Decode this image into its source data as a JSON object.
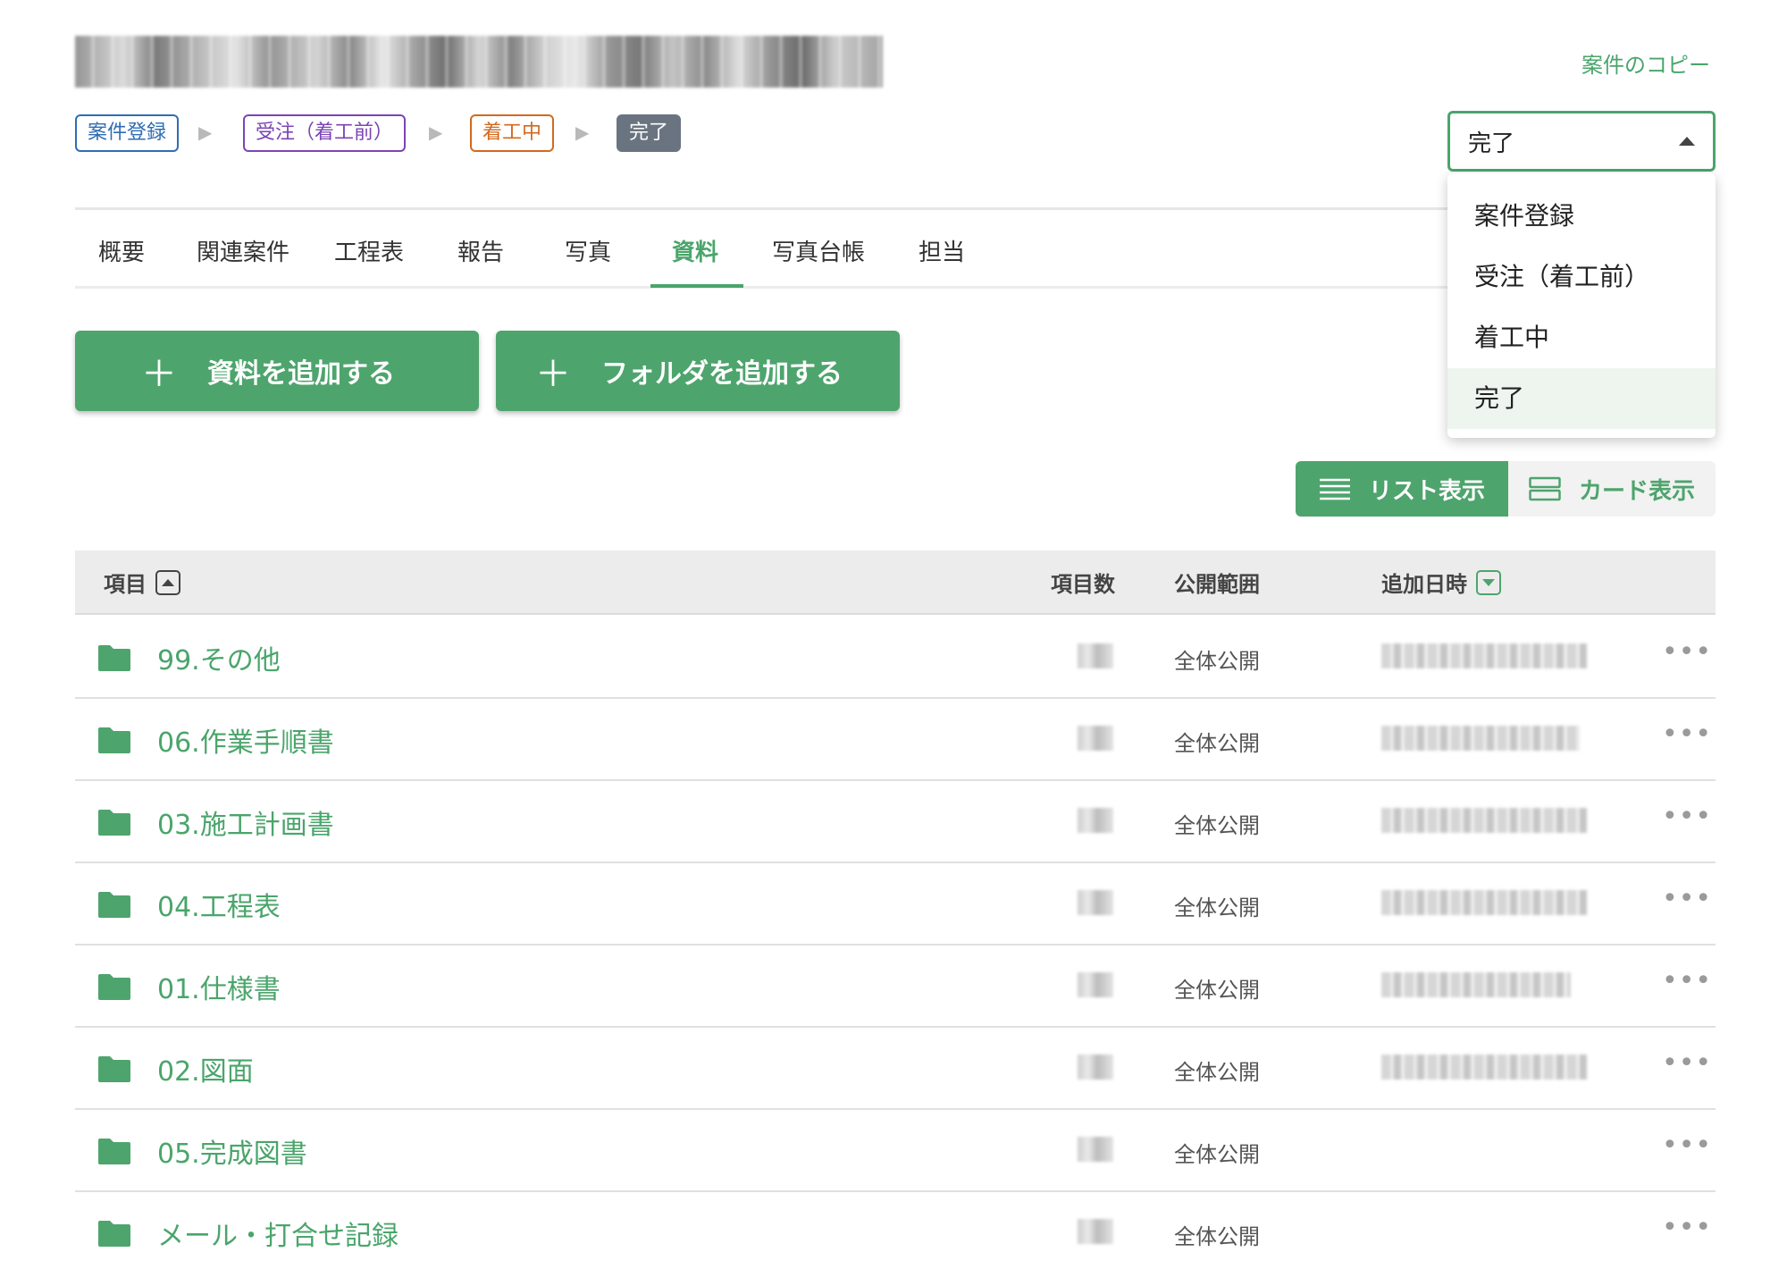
{
  "header": {
    "copy_label": "案件のコピー"
  },
  "status_flow": {
    "steps": [
      "案件登録",
      "受注（着工前）",
      "着工中",
      "完了"
    ],
    "arrow": "▶"
  },
  "status_select": {
    "value": "完了",
    "options": [
      "案件登録",
      "受注（着工前）",
      "着工中",
      "完了"
    ]
  },
  "tabs": [
    "概要",
    "関連案件",
    "工程表",
    "報告",
    "写真",
    "資料",
    "写真台帳",
    "担当"
  ],
  "active_tab": "資料",
  "actions": {
    "add_document": "資料を追加する",
    "add_folder": "フォルダを追加する",
    "plus": "＋"
  },
  "view_toggle": {
    "list": "リスト表示",
    "card": "カード表示"
  },
  "table": {
    "columns": {
      "item": "項目",
      "count": "項目数",
      "scope": "公開範囲",
      "added": "追加日時"
    },
    "rows": [
      {
        "name": "99.その他",
        "scope": "全体公開",
        "more": "•••"
      },
      {
        "name": "06.作業手順書",
        "scope": "全体公開",
        "more": "•••"
      },
      {
        "name": "03.施工計画書",
        "scope": "全体公開",
        "more": "•••"
      },
      {
        "name": "04.工程表",
        "scope": "全体公開",
        "more": "•••"
      },
      {
        "name": "01.仕様書",
        "scope": "全体公開",
        "more": "•••"
      },
      {
        "name": "02.図面",
        "scope": "全体公開",
        "more": "•••"
      },
      {
        "name": "05.完成図書",
        "scope": "全体公開",
        "more": "•••"
      },
      {
        "name": "メール・打合せ記録",
        "scope": "全体公開",
        "more": "•••"
      }
    ]
  },
  "colors": {
    "accent": "#4aa56b",
    "button": "#4ea46d",
    "tag_registered": "#2f6db3",
    "tag_ordered": "#7b44b5",
    "tag_in_progress": "#d2691e",
    "tag_done": "#6a7481"
  },
  "icons": {
    "folder": "folder-icon",
    "list": "list-icon",
    "card": "card-icon",
    "more": "more-icon"
  }
}
